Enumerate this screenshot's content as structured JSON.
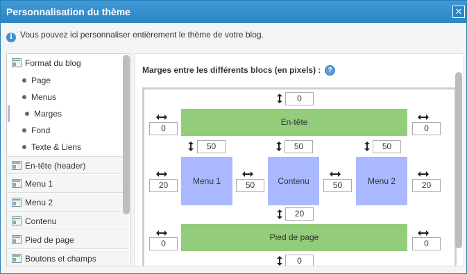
{
  "dialog": {
    "title": "Personnalisation du thème",
    "close_label": "✕",
    "info_text": "Vous pouvez ici personnaliser entièrement le thème de votre blog.",
    "info_icon": "i"
  },
  "sidebar": {
    "items": [
      {
        "label": "Format du blog"
      },
      {
        "label": "Page"
      },
      {
        "label": "Menus"
      },
      {
        "label": "Marges"
      },
      {
        "label": "Fond"
      },
      {
        "label": "Texte & Liens"
      },
      {
        "label": "En-tête (header)"
      },
      {
        "label": "Menu 1"
      },
      {
        "label": "Menu 2"
      },
      {
        "label": "Contenu"
      },
      {
        "label": "Pied de page"
      },
      {
        "label": "Boutons et champs"
      }
    ],
    "active": "Marges"
  },
  "main": {
    "heading": "Marges entre les différents blocs (en pixels) :",
    "help_icon": "?",
    "blocks": {
      "header": "En-tête",
      "menu1": "Menu 1",
      "content": "Contenu",
      "menu2": "Menu 2",
      "footer": "Pied de page"
    },
    "margins": {
      "top": "0",
      "header_left": "0",
      "header_right": "0",
      "menu1_top": "50",
      "content_top": "50",
      "menu2_top": "50",
      "menu1_left": "20",
      "menu1_content": "50",
      "content_menu2": "50",
      "menu2_right": "20",
      "above_footer": "20",
      "footer_left": "0",
      "footer_right": "0",
      "bottom": "0"
    }
  },
  "colors": {
    "header_bar": "#2b86c5",
    "green_block": "#93cc7a",
    "blue_block": "#aab8ff"
  }
}
